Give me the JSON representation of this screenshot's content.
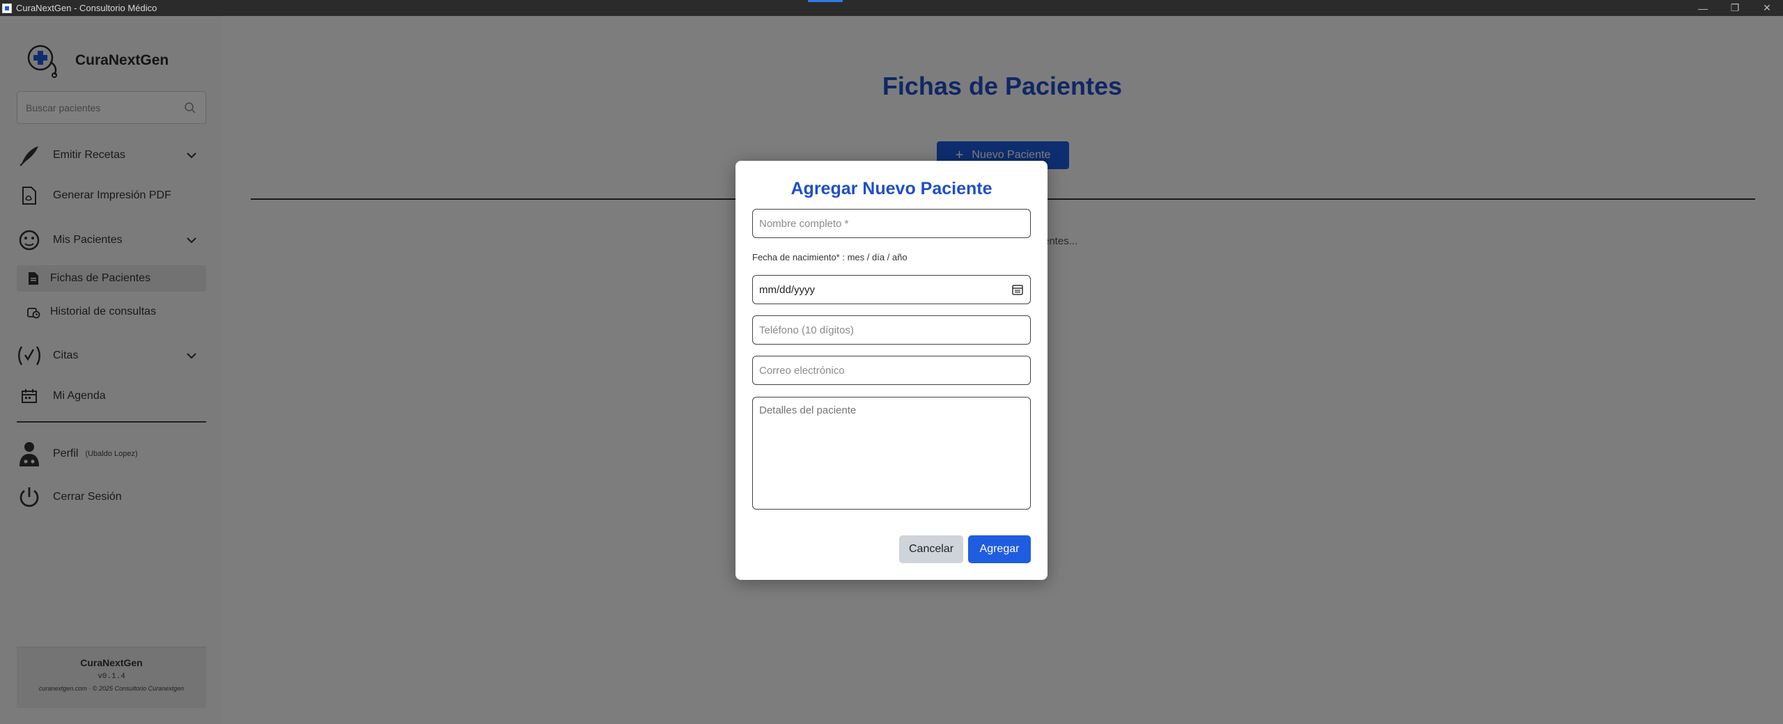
{
  "window": {
    "title": "CuraNextGen - Consultorio Médico",
    "controls": [
      "—",
      "❐",
      "✕"
    ]
  },
  "brand": {
    "name": "CuraNextGen"
  },
  "search": {
    "placeholder": "Buscar pacientes"
  },
  "nav": {
    "emitir_recetas": "Emitir Recetas",
    "generar_pdf": "Generar Impresión PDF",
    "mis_pacientes": "Mis Pacientes",
    "fichas": "Fichas de Pacientes",
    "historial": "Historial de consultas",
    "citas": "Citas",
    "agenda": "Mi Agenda",
    "perfil": "Perfil",
    "perfil_user": "(Ubaldo Lopez)",
    "cerrar": "Cerrar Sesión"
  },
  "footer": {
    "name": "CuraNextGen",
    "version": "v0.1.4",
    "copyright": "curanextgen.com · © 2025 Consultorio Curanextgen"
  },
  "main": {
    "title": "Fichas de Pacientes",
    "new_button": "Nuevo Paciente",
    "loading_text": "entes..."
  },
  "modal": {
    "title": "Agregar Nuevo Paciente",
    "name_placeholder": "Nombre completo *",
    "date_label": "Fecha de nacimiento* : mes / día / año",
    "date_value": "mm/dd/yyyy",
    "phone_placeholder": "Teléfono (10 dígitos)",
    "email_placeholder": "Correo electrónico",
    "details_placeholder": "Detalles del paciente",
    "cancel": "Cancelar",
    "add": "Agregar"
  },
  "colors": {
    "accent": "#1f5ce0",
    "title": "#1f4fc9",
    "titlebar": "#2b2b2b"
  }
}
